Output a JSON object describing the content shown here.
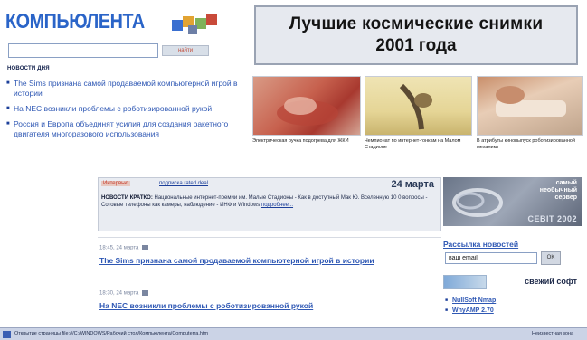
{
  "header": {
    "logo_text": "КОМПЬЮЛЕНТА",
    "search_placeholder": "",
    "search_button": "найти"
  },
  "banner": {
    "line1": "Лучшие космические снимки",
    "line2": "2001 года"
  },
  "left_news": {
    "heading": "НОВОСТИ ДНЯ",
    "items": [
      "The Sims признана самой продаваемой компьютерной игрой в истории",
      "На NEC возникли проблемы с роботизированной рукой",
      "Россия и Европа объединят усилия для создания ракетного двигателя многоразового использования"
    ]
  },
  "photos": {
    "captions": [
      "Электрическая ручка подогрева для ЖКИ",
      "Чемпионат по интернет-гонкам на Малом Стадионе",
      "В атрибуты киновыпуск роботизированной механики"
    ]
  },
  "main_article": {
    "tag": "Интервью",
    "tag_link": "подписка  rated deal",
    "date": "24 марта",
    "text_bold": "НОВОСТИ КРАТКО:",
    "text": " Национальные интернет-премии им. Малые Стадионы - Как в доступный Мак Ю. Вселенную 10 0 вопросы - Сотовые телефоны как камеры, наблюдение - ИНФ и Windows ",
    "more_link": "подробнее..."
  },
  "articles": [
    {
      "meta": "18:45, 24 марта",
      "title": "The Sims признана самой продаваемой компьютерной игрой в истории"
    },
    {
      "meta": "18:30, 24 марта",
      "title": "На NEC возникли проблемы с роботизированной рукой"
    }
  ],
  "right": {
    "softad_line1": "самый",
    "softad_line2": "необычный",
    "softad_line3": "сервер",
    "softad_bottom": "CEBIT 2002",
    "rassylka": "Рассылка новостей",
    "email_value": "ваш email",
    "email_button": "OK",
    "soft_title": "свежий софт",
    "soft_items": [
      "NullSoft Nmap",
      "WhyAMP 2.70"
    ]
  },
  "statusbar": {
    "text": "Открытие страницы file:///C:/WINDOWS/Рабочий стол/Компьюлента/Computerra.htm",
    "zone": "Неизвестная зона"
  },
  "colors": {
    "logo_blue": "#2a64c8",
    "link_blue": "#2f58b4",
    "tag_red": "#c53b2b"
  }
}
